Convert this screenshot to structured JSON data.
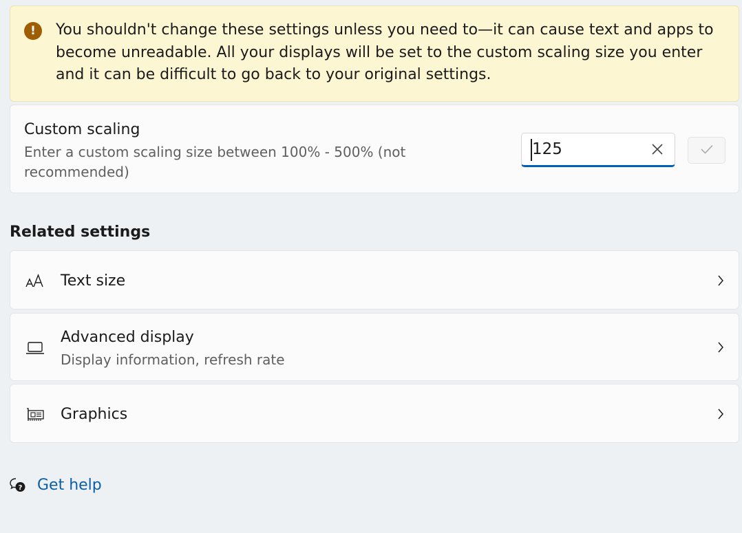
{
  "warning": {
    "icon": "exclamation-icon",
    "text": "You shouldn't change these settings unless you need to—it can cause text and apps to become unreadable. All your displays will be set to the custom scaling size you enter and it can be difficult to go back to your original settings.",
    "color": "#9d5d00"
  },
  "custom_scaling": {
    "title": "Custom scaling",
    "description": "Enter a custom scaling size between 100% - 500% (not recommended)",
    "input_value": "125",
    "clear_icon": "close-icon",
    "confirm_icon": "checkmark-icon"
  },
  "related": {
    "heading": "Related settings",
    "items": [
      {
        "icon": "text-size-icon",
        "title": "Text size",
        "subtitle": ""
      },
      {
        "icon": "laptop-icon",
        "title": "Advanced display",
        "subtitle": "Display information, refresh rate"
      },
      {
        "icon": "graphics-card-icon",
        "title": "Graphics",
        "subtitle": ""
      }
    ]
  },
  "help": {
    "icon": "help-chat-icon",
    "label": "Get help"
  },
  "colors": {
    "accent": "#005fb8",
    "link": "#0b5ea8",
    "warning_bg": "#fdf6d3"
  }
}
